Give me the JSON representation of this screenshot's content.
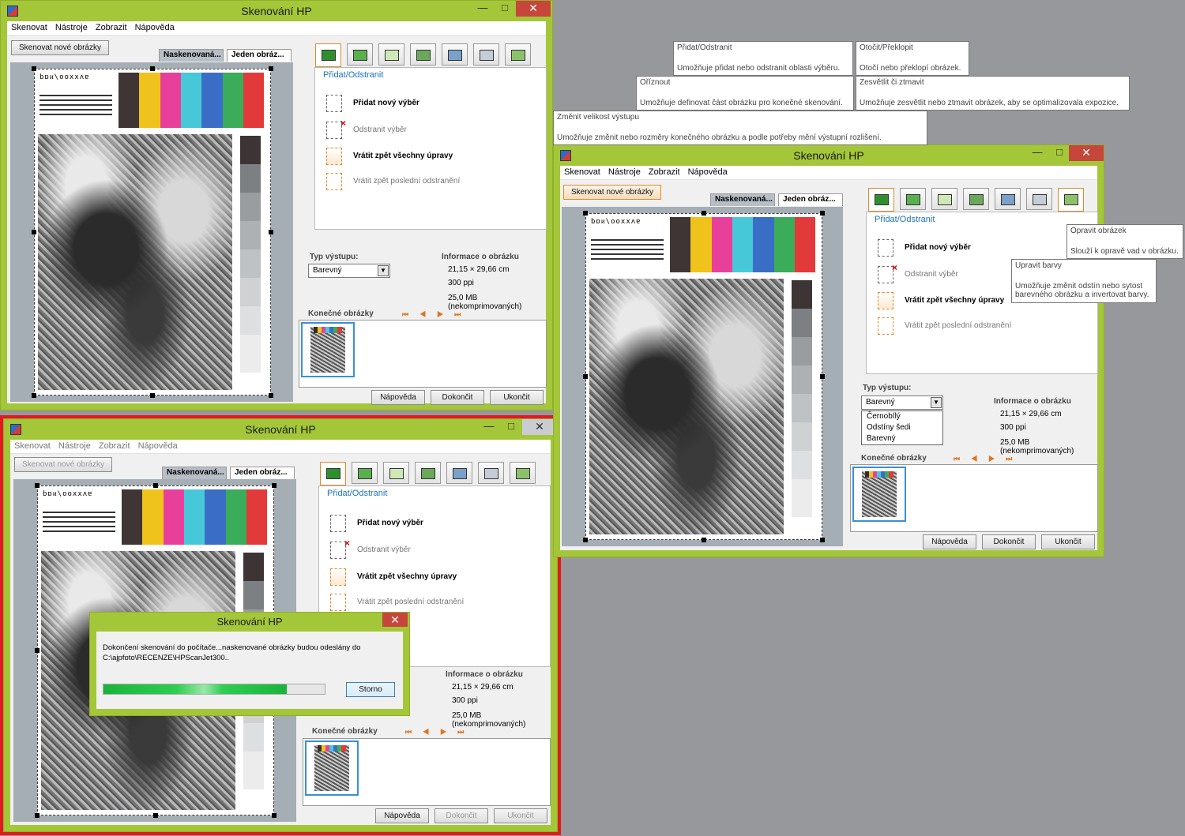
{
  "window": {
    "title": "Skenování HP",
    "min": "—",
    "max": "□",
    "close": "✕"
  },
  "menu": [
    "Skenovat",
    "Nástroje",
    "Zobrazit",
    "Nápověda"
  ],
  "scan_new_button": "Skenovat nové obrázky",
  "left_tabs": [
    "Naskenovaná...",
    "Jeden obráz..."
  ],
  "tool_tabs": [
    "add-remove-icon",
    "rotate-flip-icon",
    "crop-icon",
    "resize-icon",
    "lighten-darken-icon",
    "color-adjust-icon",
    "fix-image-icon"
  ],
  "panel": {
    "title": "Přidat/Odstranit",
    "actions": [
      "Přidat nový výběr",
      "Odstranit výběr",
      "Vrátit zpět všechny úpravy",
      "Vrátit zpět poslední odstranění"
    ]
  },
  "output": {
    "label": "Typ výstupu:",
    "value": "Barevný",
    "options": [
      "Černobílý",
      "Odstíny šedi",
      "Barevný"
    ]
  },
  "info": {
    "label": "Informace o obrázku",
    "size": "21,15 × 29,66 cm",
    "resolution": "300 ppi",
    "filesize": "25,0 MB (nekomprimovaných)"
  },
  "final_label": "Konečné obrázky",
  "nav_arrows": "⏮◀▶⏭",
  "bottom_buttons": [
    "Nápověda",
    "Dokončit",
    "Ukončit"
  ],
  "target_text": "bɒᴎ\\ooxxʌɐ",
  "tooltips": [
    {
      "title": "Přidat/Odstranit",
      "body": "Umožňuje přidat nebo odstranit oblasti výběru."
    },
    {
      "title": "Otočit/Překlopit",
      "body": "Otočí nebo překlopí obrázek."
    },
    {
      "title": "Oříznout",
      "body": "Umožňuje definovat část obrázku pro konečné skenování."
    },
    {
      "title": "Zesvětlit či ztmavit",
      "body": "Umožňuje zesvětlit nebo ztmavit obrázek, aby se optimalizovala expozice."
    },
    {
      "title": "Změnit velikost výstupu",
      "body": "Umožňuje změnit nebo rozměry konečného obrázku a podle potřeby mění výstupní rozlišení."
    },
    {
      "title": "Opravit obrázek",
      "body": "Slouží k opravě vad v obrázku."
    },
    {
      "title": "Upravit barvy",
      "body": "Umožňuje změnit odstín nebo sytost barevného obrázku a invertovat barvy."
    }
  ],
  "dialog": {
    "title": "Skenování HP",
    "message": "Dokončení skenování do počítače...naskenované obrázky budou odeslány do C:\\ajpfoto\\RECENZE\\HPScanJet300..",
    "cancel": "Storno",
    "progress": 0.83
  }
}
